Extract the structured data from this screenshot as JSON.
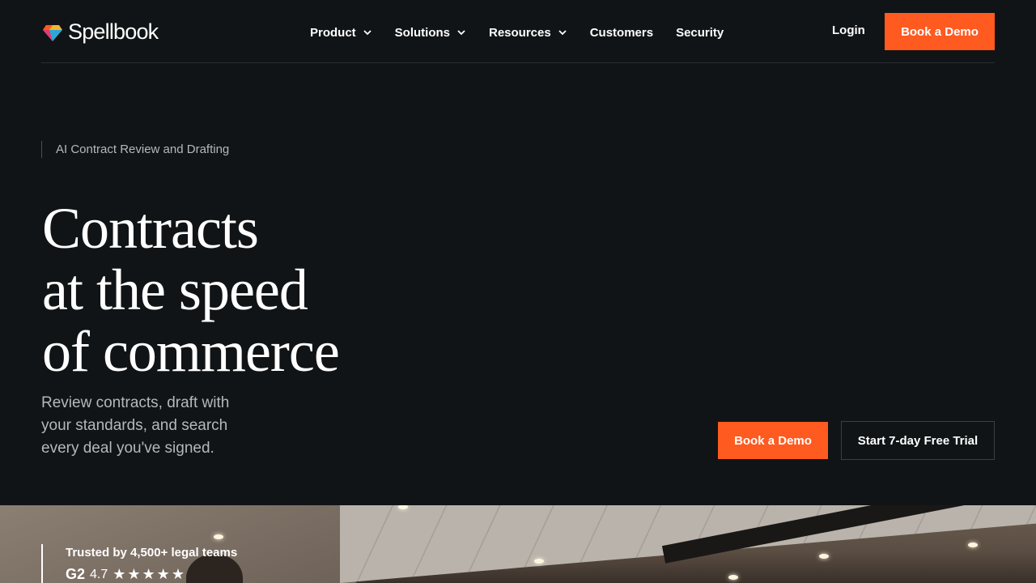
{
  "brand": {
    "name": "Spellbook",
    "logo_colors": [
      "#ff5a1f",
      "#f2b632",
      "#2fa7d6",
      "#e23b6c"
    ]
  },
  "nav": {
    "items": [
      {
        "label": "Product",
        "has_dropdown": true
      },
      {
        "label": "Solutions",
        "has_dropdown": true
      },
      {
        "label": "Resources",
        "has_dropdown": true
      },
      {
        "label": "Customers",
        "has_dropdown": false
      },
      {
        "label": "Security",
        "has_dropdown": false
      }
    ],
    "login_label": "Login",
    "cta_label": "Book a Demo"
  },
  "hero": {
    "eyebrow": "AI Contract Review and Drafting",
    "headline_lines": [
      "Contracts",
      "at the speed",
      "of commerce"
    ],
    "subtext": "Review contracts, draft with your standards, and search every deal you've signed.",
    "primary_cta": "Book a Demo",
    "secondary_cta": "Start 7-day Free Trial"
  },
  "trust": {
    "title": "Trusted by 4,500+ legal teams",
    "g2_label": "G2",
    "rating": "4.7",
    "stars": "★★★★★"
  },
  "colors": {
    "background": "#111416",
    "accent": "#ff5a1f",
    "text_primary": "#ffffff",
    "text_muted": "#b4b8bb"
  }
}
